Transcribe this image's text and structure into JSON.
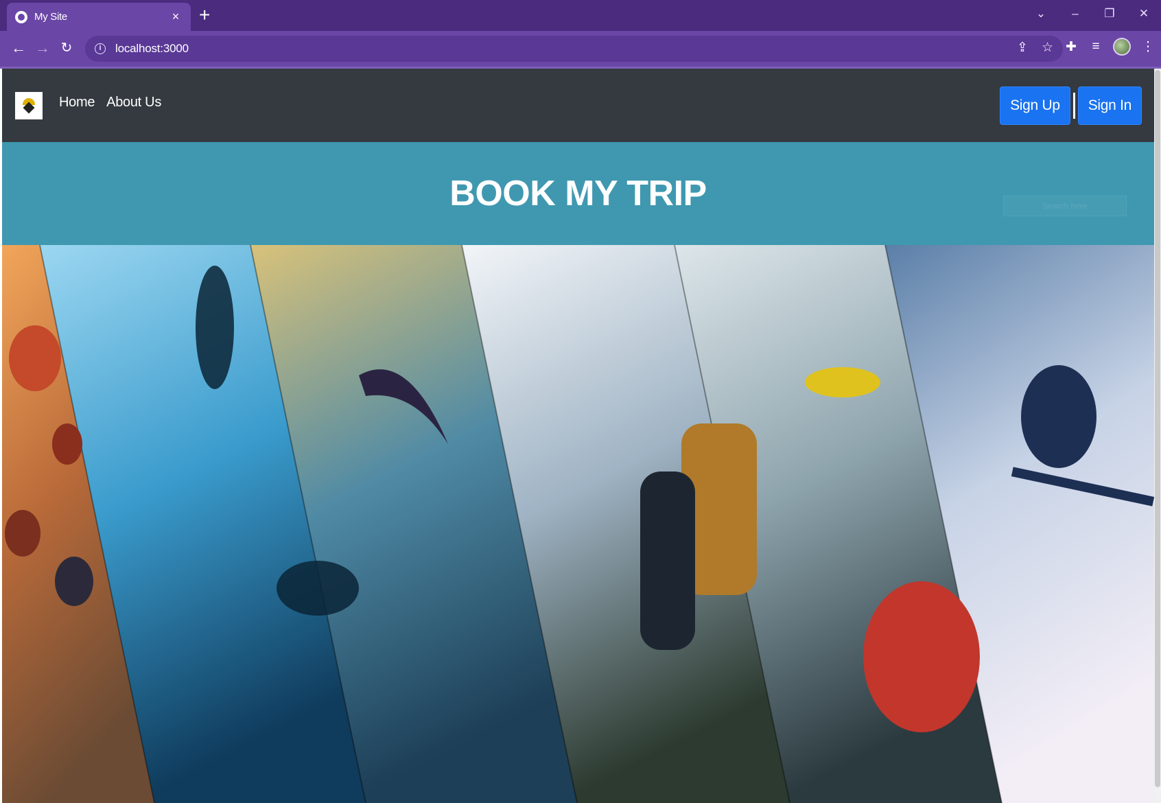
{
  "browser": {
    "tab_title": "My Site",
    "tab_close": "×",
    "new_tab": "+",
    "url": "localhost:3000",
    "window_controls": [
      "⌄",
      "–",
      "❐",
      "✕"
    ]
  },
  "navbar": {
    "links": [
      {
        "label": "Home"
      },
      {
        "label": "About Us"
      }
    ],
    "sign_up": "Sign Up",
    "sign_in": "Sign In"
  },
  "banner": {
    "title": "BOOK MY TRIP",
    "search_placeholder": "Search here"
  },
  "collage": {
    "panels": [
      {
        "name": "hot-air-balloons",
        "colors": [
          "#f1a65a",
          "#b96a39",
          "#6b4b34"
        ]
      },
      {
        "name": "scuba-diving",
        "colors": [
          "#9cd7f1",
          "#3a9bcc",
          "#0f3b5c"
        ]
      },
      {
        "name": "paragliding",
        "colors": [
          "#d9c27a",
          "#4f8aa5",
          "#1d3f57"
        ]
      },
      {
        "name": "hiking",
        "colors": [
          "#f2f5f8",
          "#9fb3c4",
          "#2c3a2f"
        ]
      },
      {
        "name": "white-water-rafting",
        "colors": [
          "#dde6ea",
          "#8ea4ad",
          "#2b3a3f"
        ]
      },
      {
        "name": "skiing",
        "colors": [
          "#5b7fa8",
          "#c7d3e6",
          "#f3eef6"
        ]
      }
    ]
  }
}
